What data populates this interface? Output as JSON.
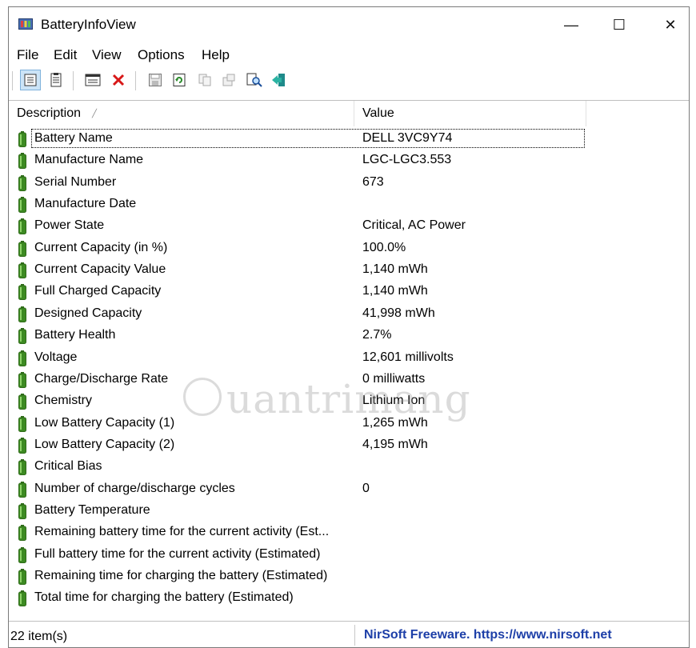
{
  "window": {
    "title": "BatteryInfoView",
    "min_glyph": "—",
    "max_glyph": "☐",
    "close_glyph": "✕"
  },
  "menu": [
    "File",
    "Edit",
    "View",
    "Options",
    "Help"
  ],
  "toolbar": [
    {
      "name": "html-report-selected-icon"
    },
    {
      "name": "html-report-all-icon"
    },
    {
      "name": "properties-icon"
    },
    {
      "name": "delete-icon"
    },
    {
      "name": "save-icon"
    },
    {
      "name": "refresh-icon"
    },
    {
      "name": "copy-icon"
    },
    {
      "name": "options-icon"
    },
    {
      "name": "find-icon"
    },
    {
      "name": "exit-icon"
    }
  ],
  "columns": {
    "description": "Description",
    "value": "Value"
  },
  "rows": [
    {
      "desc": "Battery Name",
      "val": "DELL 3VC9Y74"
    },
    {
      "desc": "Manufacture Name",
      "val": "LGC-LGC3.553"
    },
    {
      "desc": "Serial Number",
      "val": "673"
    },
    {
      "desc": "Manufacture Date",
      "val": ""
    },
    {
      "desc": "Power State",
      "val": "Critical, AC Power"
    },
    {
      "desc": "Current Capacity (in %)",
      "val": "100.0%"
    },
    {
      "desc": "Current Capacity Value",
      "val": "1,140 mWh"
    },
    {
      "desc": "Full Charged Capacity",
      "val": "1,140 mWh"
    },
    {
      "desc": "Designed Capacity",
      "val": "41,998 mWh"
    },
    {
      "desc": "Battery Health",
      "val": "2.7%"
    },
    {
      "desc": "Voltage",
      "val": "12,601 millivolts"
    },
    {
      "desc": "Charge/Discharge Rate",
      "val": "0 milliwatts"
    },
    {
      "desc": "Chemistry",
      "val": "Lithium Ion"
    },
    {
      "desc": "Low Battery Capacity (1)",
      "val": "1,265 mWh"
    },
    {
      "desc": "Low Battery Capacity (2)",
      "val": "4,195 mWh"
    },
    {
      "desc": "Critical Bias",
      "val": ""
    },
    {
      "desc": "Number of charge/discharge cycles",
      "val": "0"
    },
    {
      "desc": "Battery Temperature",
      "val": ""
    },
    {
      "desc": "Remaining battery time for the current activity (Est...",
      "val": ""
    },
    {
      "desc": "Full battery time for the current activity (Estimated)",
      "val": ""
    },
    {
      "desc": "Remaining time for charging the battery (Estimated)",
      "val": ""
    },
    {
      "desc": "Total  time for charging the battery (Estimated)",
      "val": ""
    }
  ],
  "selected_row": 0,
  "status": {
    "count": "22 item(s)",
    "link": "NirSoft Freeware. https://www.nirsoft.net"
  },
  "watermark": "uantrimang",
  "colors": {
    "battery": "#3d8a22",
    "link": "#1d3fa8"
  }
}
